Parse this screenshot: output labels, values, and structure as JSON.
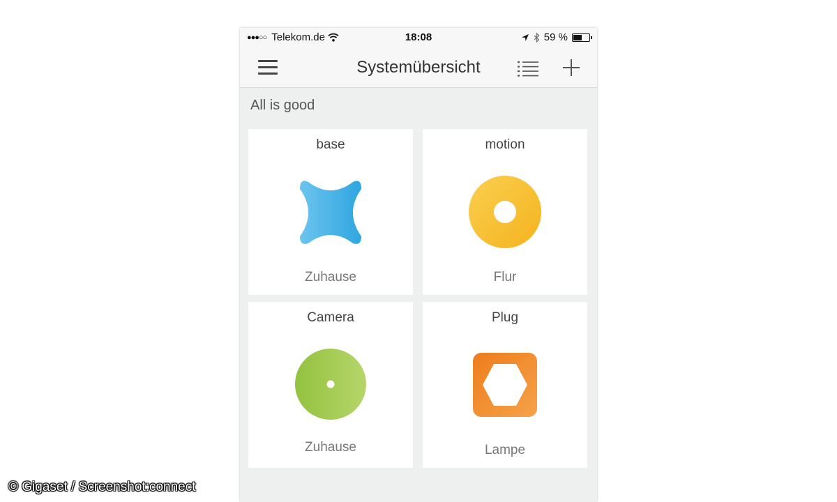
{
  "statusbar": {
    "signal": "●●●○○",
    "carrier": "Telekom.de",
    "time": "18:08",
    "battery_text": "59 %",
    "battery_level": 0.59
  },
  "navbar": {
    "title": "Systemübersicht",
    "menu_icon": "hamburger-icon",
    "list_icon": "list-icon",
    "add_icon": "plus-icon"
  },
  "status_message": "All is good",
  "tiles": [
    {
      "type": "base",
      "room": "Zuhause",
      "icon": "base-icon",
      "color": "#3fb0e8"
    },
    {
      "type": "motion",
      "room": "Flur",
      "icon": "motion-icon",
      "color": "#f7bd2a"
    },
    {
      "type": "Camera",
      "room": "Zuhause",
      "icon": "camera-icon",
      "color": "#9fc94a"
    },
    {
      "type": "Plug",
      "room": "Lampe",
      "icon": "plug-icon",
      "color": "#f0892a"
    }
  ],
  "credit": "© Gigaset / Screenshot:connect"
}
